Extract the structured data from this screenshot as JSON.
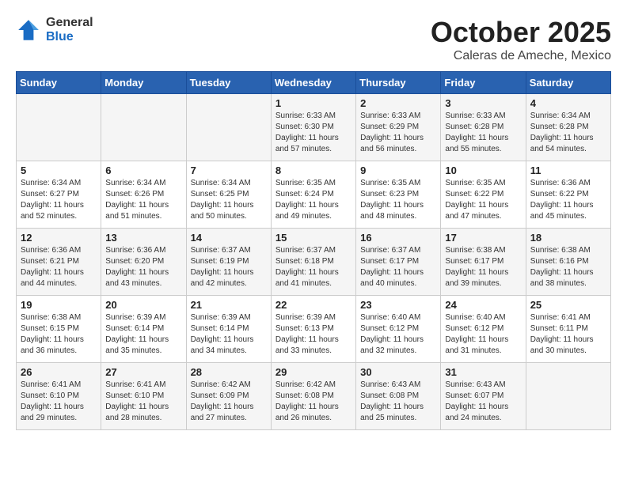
{
  "logo": {
    "general": "General",
    "blue": "Blue"
  },
  "title": "October 2025",
  "location": "Caleras de Ameche, Mexico",
  "days_of_week": [
    "Sunday",
    "Monday",
    "Tuesday",
    "Wednesday",
    "Thursday",
    "Friday",
    "Saturday"
  ],
  "weeks": [
    [
      {
        "day": "",
        "info": ""
      },
      {
        "day": "",
        "info": ""
      },
      {
        "day": "",
        "info": ""
      },
      {
        "day": "1",
        "info": "Sunrise: 6:33 AM\nSunset: 6:30 PM\nDaylight: 11 hours\nand 57 minutes."
      },
      {
        "day": "2",
        "info": "Sunrise: 6:33 AM\nSunset: 6:29 PM\nDaylight: 11 hours\nand 56 minutes."
      },
      {
        "day": "3",
        "info": "Sunrise: 6:33 AM\nSunset: 6:28 PM\nDaylight: 11 hours\nand 55 minutes."
      },
      {
        "day": "4",
        "info": "Sunrise: 6:34 AM\nSunset: 6:28 PM\nDaylight: 11 hours\nand 54 minutes."
      }
    ],
    [
      {
        "day": "5",
        "info": "Sunrise: 6:34 AM\nSunset: 6:27 PM\nDaylight: 11 hours\nand 52 minutes."
      },
      {
        "day": "6",
        "info": "Sunrise: 6:34 AM\nSunset: 6:26 PM\nDaylight: 11 hours\nand 51 minutes."
      },
      {
        "day": "7",
        "info": "Sunrise: 6:34 AM\nSunset: 6:25 PM\nDaylight: 11 hours\nand 50 minutes."
      },
      {
        "day": "8",
        "info": "Sunrise: 6:35 AM\nSunset: 6:24 PM\nDaylight: 11 hours\nand 49 minutes."
      },
      {
        "day": "9",
        "info": "Sunrise: 6:35 AM\nSunset: 6:23 PM\nDaylight: 11 hours\nand 48 minutes."
      },
      {
        "day": "10",
        "info": "Sunrise: 6:35 AM\nSunset: 6:22 PM\nDaylight: 11 hours\nand 47 minutes."
      },
      {
        "day": "11",
        "info": "Sunrise: 6:36 AM\nSunset: 6:22 PM\nDaylight: 11 hours\nand 45 minutes."
      }
    ],
    [
      {
        "day": "12",
        "info": "Sunrise: 6:36 AM\nSunset: 6:21 PM\nDaylight: 11 hours\nand 44 minutes."
      },
      {
        "day": "13",
        "info": "Sunrise: 6:36 AM\nSunset: 6:20 PM\nDaylight: 11 hours\nand 43 minutes."
      },
      {
        "day": "14",
        "info": "Sunrise: 6:37 AM\nSunset: 6:19 PM\nDaylight: 11 hours\nand 42 minutes."
      },
      {
        "day": "15",
        "info": "Sunrise: 6:37 AM\nSunset: 6:18 PM\nDaylight: 11 hours\nand 41 minutes."
      },
      {
        "day": "16",
        "info": "Sunrise: 6:37 AM\nSunset: 6:17 PM\nDaylight: 11 hours\nand 40 minutes."
      },
      {
        "day": "17",
        "info": "Sunrise: 6:38 AM\nSunset: 6:17 PM\nDaylight: 11 hours\nand 39 minutes."
      },
      {
        "day": "18",
        "info": "Sunrise: 6:38 AM\nSunset: 6:16 PM\nDaylight: 11 hours\nand 38 minutes."
      }
    ],
    [
      {
        "day": "19",
        "info": "Sunrise: 6:38 AM\nSunset: 6:15 PM\nDaylight: 11 hours\nand 36 minutes."
      },
      {
        "day": "20",
        "info": "Sunrise: 6:39 AM\nSunset: 6:14 PM\nDaylight: 11 hours\nand 35 minutes."
      },
      {
        "day": "21",
        "info": "Sunrise: 6:39 AM\nSunset: 6:14 PM\nDaylight: 11 hours\nand 34 minutes."
      },
      {
        "day": "22",
        "info": "Sunrise: 6:39 AM\nSunset: 6:13 PM\nDaylight: 11 hours\nand 33 minutes."
      },
      {
        "day": "23",
        "info": "Sunrise: 6:40 AM\nSunset: 6:12 PM\nDaylight: 11 hours\nand 32 minutes."
      },
      {
        "day": "24",
        "info": "Sunrise: 6:40 AM\nSunset: 6:12 PM\nDaylight: 11 hours\nand 31 minutes."
      },
      {
        "day": "25",
        "info": "Sunrise: 6:41 AM\nSunset: 6:11 PM\nDaylight: 11 hours\nand 30 minutes."
      }
    ],
    [
      {
        "day": "26",
        "info": "Sunrise: 6:41 AM\nSunset: 6:10 PM\nDaylight: 11 hours\nand 29 minutes."
      },
      {
        "day": "27",
        "info": "Sunrise: 6:41 AM\nSunset: 6:10 PM\nDaylight: 11 hours\nand 28 minutes."
      },
      {
        "day": "28",
        "info": "Sunrise: 6:42 AM\nSunset: 6:09 PM\nDaylight: 11 hours\nand 27 minutes."
      },
      {
        "day": "29",
        "info": "Sunrise: 6:42 AM\nSunset: 6:08 PM\nDaylight: 11 hours\nand 26 minutes."
      },
      {
        "day": "30",
        "info": "Sunrise: 6:43 AM\nSunset: 6:08 PM\nDaylight: 11 hours\nand 25 minutes."
      },
      {
        "day": "31",
        "info": "Sunrise: 6:43 AM\nSunset: 6:07 PM\nDaylight: 11 hours\nand 24 minutes."
      },
      {
        "day": "",
        "info": ""
      }
    ]
  ]
}
